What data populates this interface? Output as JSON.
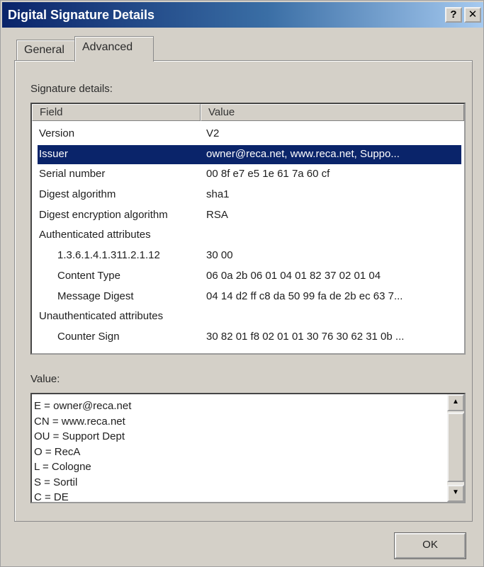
{
  "window": {
    "title": "Digital Signature Details"
  },
  "titlebar_buttons": {
    "help": "?",
    "close": "✕"
  },
  "tabs": [
    {
      "label": "General"
    },
    {
      "label": "Advanced"
    }
  ],
  "signature_details": {
    "label": "Signature details:",
    "columns": {
      "field": "Field",
      "value": "Value"
    },
    "rows": [
      {
        "field": "Version",
        "value": "V2"
      },
      {
        "field": "Issuer",
        "value": "owner@reca.net, www.reca.net, Suppo..."
      },
      {
        "field": "Serial number",
        "value": "00 8f e7 e5 1e 61 7a 60 cf"
      },
      {
        "field": "Digest algorithm",
        "value": "sha1"
      },
      {
        "field": "Digest encryption algorithm",
        "value": "RSA"
      },
      {
        "field": "Authenticated attributes",
        "value": ""
      },
      {
        "field": "1.3.6.1.4.1.311.2.1.12",
        "value": "30 00"
      },
      {
        "field": "Content Type",
        "value": "06 0a 2b 06 01 04 01 82 37 02 01 04"
      },
      {
        "field": "Message Digest",
        "value": "04 14 d2 ff c8 da 50 99 fa de 2b ec 63 7..."
      },
      {
        "field": "Unauthenticated attributes",
        "value": ""
      },
      {
        "field": "Counter Sign",
        "value": "30 82 01 f8 02 01 01 30 76 30 62 31 0b ..."
      }
    ],
    "selected_row": "Issuer"
  },
  "value_panel": {
    "label": "Value:",
    "lines": [
      "E = owner@reca.net",
      "CN = www.reca.net",
      "OU = Support Dept",
      "O = RecA",
      "L = Cologne",
      "S = Sortil",
      "C = DE"
    ],
    "scroll_up": "▲",
    "scroll_down": "▼"
  },
  "buttons": {
    "ok": "OK"
  },
  "colors": {
    "selection": "#0a246a",
    "titlebar_start": "#0a246a",
    "titlebar_end": "#a6caf0",
    "dialog_face": "#d4d0c8"
  }
}
